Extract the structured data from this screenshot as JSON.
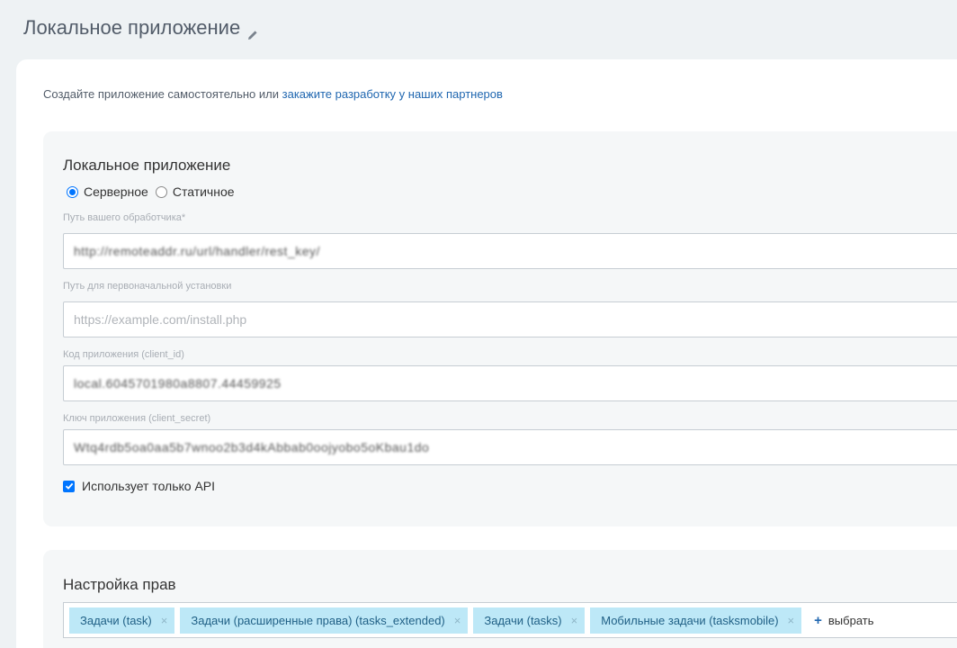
{
  "header": {
    "title": "Локальное приложение",
    "edit_icon": "pencil-icon"
  },
  "intro": {
    "text": "Создайте приложение самостоятельно или ",
    "link": "закажите разработку у наших партнеров"
  },
  "app_settings": {
    "title": "Локальное приложение",
    "type_options": [
      {
        "label": "Серверное",
        "checked": true
      },
      {
        "label": "Статичное",
        "checked": false
      }
    ],
    "handler_path": {
      "label": "Путь вашего обработчика*",
      "value": "http://remoteaddr.ru/url/handler/rest_key/"
    },
    "install_path": {
      "label": "Путь для первоначальной установки",
      "placeholder": "https://example.com/install.php"
    },
    "client_id": {
      "label": "Код приложения (client_id)",
      "value": "local.6045701980a8807.44459925"
    },
    "client_secret": {
      "label": "Ключ приложения (client_secret)",
      "value": "Wtq4rdb5oa0aa5b7wnoo2b3d4kAbbab0oojyobo5oKbau1do"
    },
    "api_only": {
      "label": "Использует только API",
      "checked": true
    }
  },
  "permissions": {
    "title": "Настройка прав",
    "tags": [
      {
        "label": "Задачи (task)"
      },
      {
        "label": "Задачи (расширенные права) (tasks_extended)"
      },
      {
        "label": "Задачи (tasks)"
      },
      {
        "label": "Мобильные задачи (tasksmobile)"
      }
    ],
    "remove_symbol": "×",
    "select_label": "выбрать",
    "select_icon": "plus-icon"
  },
  "colors": {
    "background": "#eef2f4",
    "link": "#2067b0",
    "accent": "#0075ff",
    "tag_bg": "#bde8f7"
  }
}
